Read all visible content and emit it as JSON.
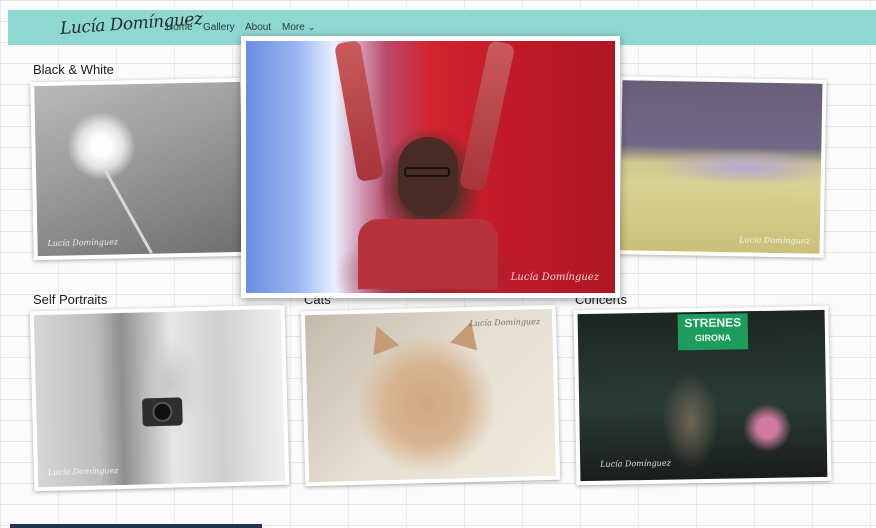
{
  "nav": {
    "brand": "Lucía Domínguez",
    "links": [
      {
        "label": "Home"
      },
      {
        "label": "Gallery"
      },
      {
        "label": "About"
      },
      {
        "label": "More"
      }
    ]
  },
  "sections": {
    "black_white": "Black & White",
    "self_portraits": "Self Portraits",
    "cats": "Cats",
    "concerts": "Concerts"
  },
  "photos": {
    "signature": "Lucía Domínguez",
    "concert_banner": [
      "STRENES",
      "GIRONA"
    ]
  },
  "colors": {
    "navbar": "#8fd8d2",
    "footer": "#1f3350"
  }
}
